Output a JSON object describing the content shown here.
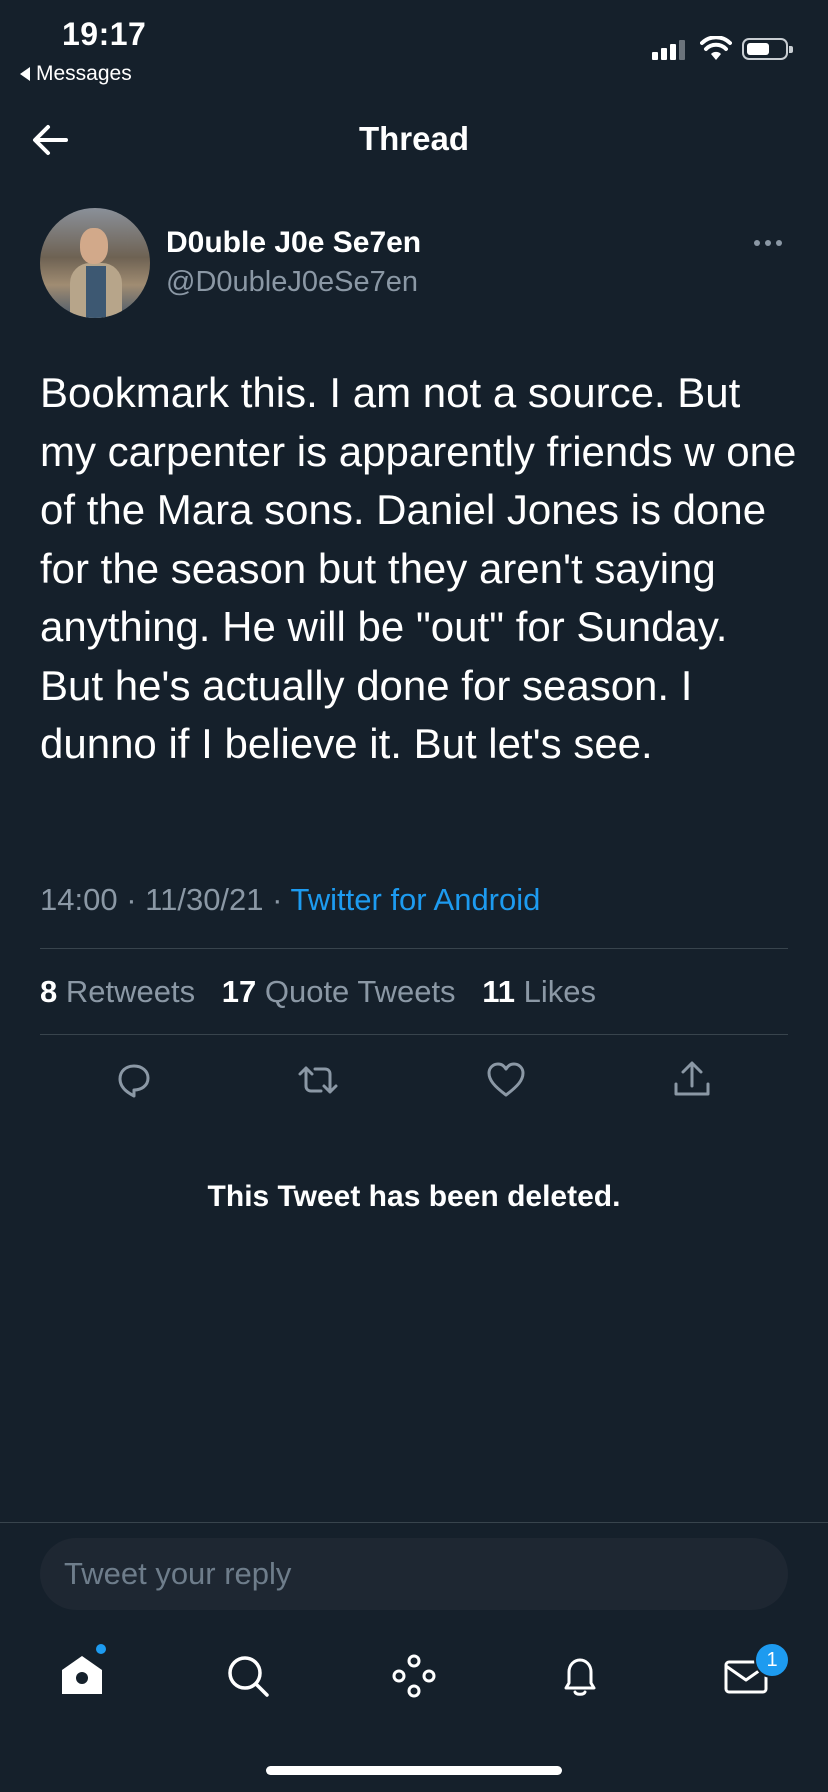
{
  "status_bar": {
    "time": "19:17",
    "back_app": "Messages"
  },
  "header": {
    "title": "Thread"
  },
  "tweet": {
    "display_name": "D0uble J0e Se7en",
    "handle": "@D0ubleJ0eSe7en",
    "text": "Bookmark this. I am not a source. But my carpenter is apparently friends w one of the Mara sons. Daniel Jones is done for the season but they aren't saying anything. He will be \"out\" for Sunday. But he's actually done for season. I dunno if I believe it. But let's see.",
    "time": "14:00",
    "date": "11/30/21",
    "separator": "·",
    "source": "Twitter for Android",
    "stats": {
      "retweets_count": "8",
      "retweets_label": "Retweets",
      "quotes_count": "17",
      "quotes_label": "Quote Tweets",
      "likes_count": "11",
      "likes_label": "Likes"
    }
  },
  "deleted_notice": "This Tweet has been deleted.",
  "composer": {
    "placeholder": "Tweet your reply"
  },
  "tab_bar": {
    "messages_badge": "1"
  },
  "icons": {
    "back": "back-arrow-icon",
    "more": "more-horizontal-icon",
    "reply": "reply-icon",
    "retweet": "retweet-icon",
    "like": "heart-icon",
    "share": "share-icon",
    "home": "home-icon",
    "search": "search-icon",
    "spaces": "spaces-icon",
    "notifications": "bell-icon",
    "messages": "envelope-icon"
  },
  "colors": {
    "background": "#15202b",
    "accent": "#1d9bf0",
    "secondary_text": "#8b98a5",
    "divider": "#38444d"
  }
}
